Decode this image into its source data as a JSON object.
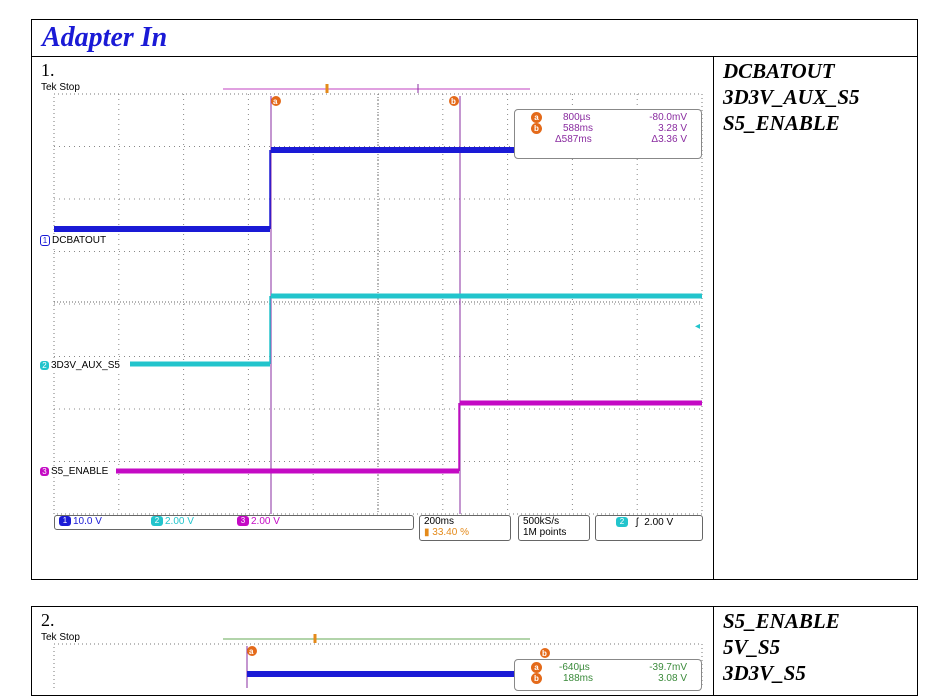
{
  "header": {
    "title": "Adapter In"
  },
  "section1": {
    "number": "1.",
    "scope_status": "Tek Stop",
    "signals": [
      "DCBATOUT",
      "3D3V_AUX_S5",
      "S5_ENABLE"
    ],
    "channel_labels": [
      "DCBATOUT",
      "3D3V_AUX_S5",
      "S5_ENABLE"
    ],
    "channel_numbers": [
      "1",
      "2",
      "3"
    ],
    "cursor_labels": [
      "a",
      "b"
    ],
    "readout": {
      "a_time": "800µs",
      "a_val": "-80.0mV",
      "b_time": "588ms",
      "b_val": "3.28 V",
      "d_time": "Δ587ms",
      "d_val": "Δ3.36 V"
    },
    "scales": {
      "ch1": "10.0 V",
      "ch2": "2.00 V",
      "ch3": "2.00 V"
    },
    "timebase": "200ms",
    "position": "33.40 %",
    "sample": "500kS/s",
    "points": "1M points",
    "trigger": "2.00 V",
    "trigger_channel": "2"
  },
  "section2": {
    "number": "2.",
    "scope_status": "Tek Stop",
    "signals": [
      "S5_ENABLE",
      "5V_S5",
      "3D3V_S5"
    ],
    "readout": {
      "a_time": "-640µs",
      "a_val": "-39.7mV",
      "b_time": "188ms",
      "b_val": "3.08 V"
    }
  },
  "colors": {
    "ch1": "#1a1ad6",
    "ch2": "#22c4cc",
    "ch3": "#c40ac4",
    "cursor": "#8a2ca0",
    "accent": "#e46a1a"
  }
}
